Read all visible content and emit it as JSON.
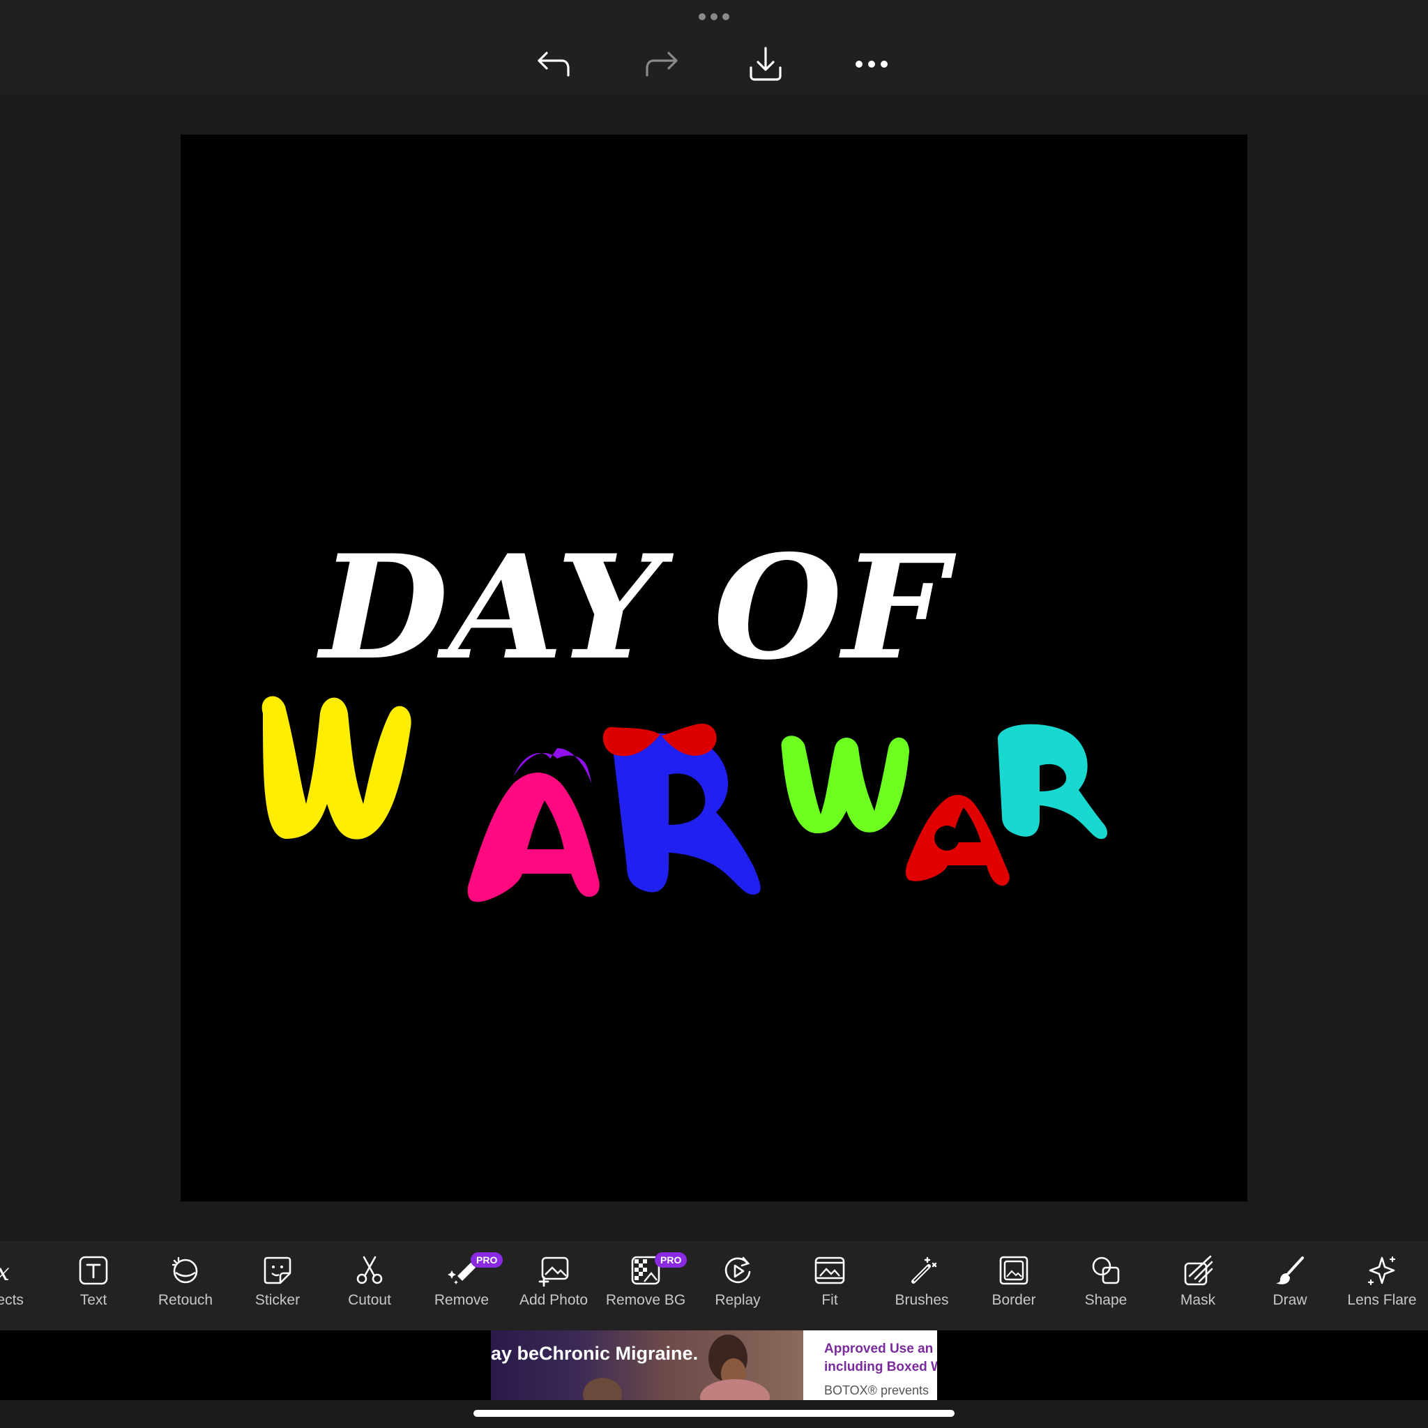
{
  "top_bar": {
    "icons": {
      "undo": "undo-arrow-icon",
      "redo": "redo-arrow-icon",
      "download": "download-icon",
      "more": "more-dots-icon"
    }
  },
  "canvas": {
    "background": "#000000",
    "title_line1": "DAY OF",
    "title_line2_letters": [
      {
        "char": "W",
        "color": "#ffee00"
      },
      {
        "char": "A",
        "color": "#ff0a80"
      },
      {
        "char": "R",
        "color": "#2020f0"
      },
      {
        "char": "W",
        "color": "#6cff20"
      },
      {
        "char": "A",
        "color": "#e00000"
      },
      {
        "char": "R",
        "color": "#18d8d0"
      }
    ],
    "decoration_colors": {
      "purple_ears": "#9010ee",
      "red_bow": "#dd0000"
    }
  },
  "toolbar": {
    "tools": [
      {
        "label": "Effects",
        "icon": "fx-icon",
        "pro": false
      },
      {
        "label": "Text",
        "icon": "text-box-icon",
        "pro": false
      },
      {
        "label": "Retouch",
        "icon": "retouch-face-icon",
        "pro": false
      },
      {
        "label": "Sticker",
        "icon": "sticker-icon",
        "pro": false
      },
      {
        "label": "Cutout",
        "icon": "scissors-icon",
        "pro": false
      },
      {
        "label": "Remove",
        "icon": "eraser-sparkle-icon",
        "pro": true
      },
      {
        "label": "Add Photo",
        "icon": "add-photo-icon",
        "pro": false
      },
      {
        "label": "Remove BG",
        "icon": "remove-bg-icon",
        "pro": true
      },
      {
        "label": "Replay",
        "icon": "replay-icon",
        "pro": false
      },
      {
        "label": "Fit",
        "icon": "fit-icon",
        "pro": false
      },
      {
        "label": "Brushes",
        "icon": "magic-brush-icon",
        "pro": false
      },
      {
        "label": "Border",
        "icon": "border-icon",
        "pro": false
      },
      {
        "label": "Shape",
        "icon": "shape-icon",
        "pro": false
      },
      {
        "label": "Mask",
        "icon": "mask-icon",
        "pro": false
      },
      {
        "label": "Draw",
        "icon": "paintbrush-icon",
        "pro": false
      },
      {
        "label": "Lens Flare",
        "icon": "sparkle-icon",
        "pro": false
      }
    ],
    "pro_badge": "PRO",
    "pro_color": "#8a2be2"
  },
  "ad": {
    "headline": "ay beChronic Migraine.",
    "right_line1": "Approved Use an",
    "right_line2": "including Boxed W",
    "right_line3": "BOTOX® prevents"
  }
}
